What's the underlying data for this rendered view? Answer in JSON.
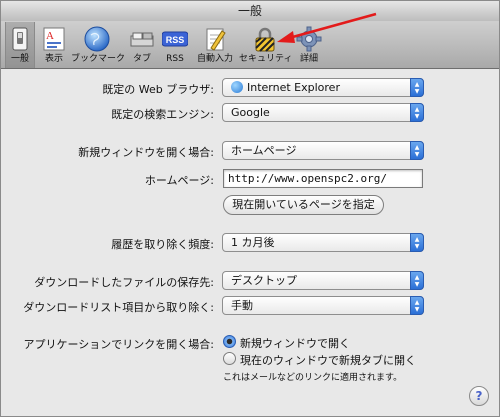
{
  "window": {
    "title": "一般"
  },
  "toolbar": {
    "items": [
      {
        "label": "一般",
        "icon": "switch-icon",
        "selected": true
      },
      {
        "label": "表示",
        "icon": "font-icon"
      },
      {
        "label": "ブックマーク",
        "icon": "globe-icon"
      },
      {
        "label": "タブ",
        "icon": "tab-icon"
      },
      {
        "label": "RSS",
        "icon": "rss-icon"
      },
      {
        "label": "自動入力",
        "icon": "pencil-icon"
      },
      {
        "label": "セキュリティ",
        "icon": "lock-icon"
      },
      {
        "label": "詳細",
        "icon": "gear-icon"
      }
    ]
  },
  "annotation": {
    "arrow_color": "#e31b1b"
  },
  "form": {
    "browser": {
      "label": "既定の Web ブラウザ:",
      "value": "Internet Explorer"
    },
    "search": {
      "label": "既定の検索エンジン:",
      "value": "Google"
    },
    "new_window": {
      "label": "新規ウィンドウを開く場合:",
      "value": "ホームページ"
    },
    "homepage": {
      "label": "ホームページ:",
      "value": "http://www.openspc2.org/",
      "button": "現在開いているページを指定"
    },
    "history": {
      "label": "履歴を取り除く頻度:",
      "value": "1 カ月後"
    },
    "download_location": {
      "label": "ダウンロードしたファイルの保存先:",
      "value": "デスクトップ"
    },
    "download_list": {
      "label": "ダウンロードリスト項目から取り除く:",
      "value": "手動"
    },
    "open_links": {
      "label": "アプリケーションでリンクを開く場合:",
      "options": [
        "新規ウィンドウで開く",
        "現在のウィンドウで新規タブに開く"
      ],
      "selected": 0,
      "note": "これはメールなどのリンクに適用されます。"
    }
  },
  "help": {
    "glyph": "?"
  }
}
